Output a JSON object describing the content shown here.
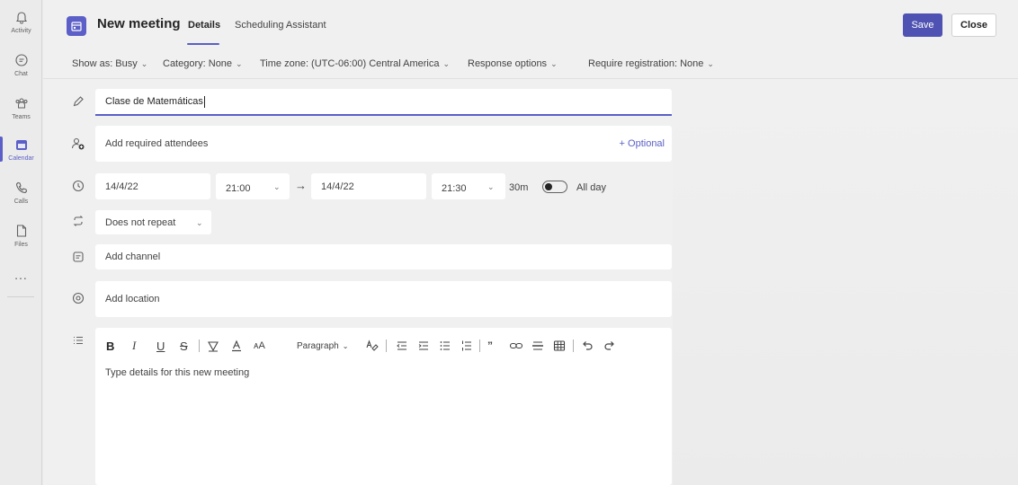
{
  "rail": {
    "items": [
      {
        "label": "Activity",
        "icon": "bell-icon"
      },
      {
        "label": "Chat",
        "icon": "chat-icon"
      },
      {
        "label": "Teams",
        "icon": "teams-icon"
      },
      {
        "label": "Calendar",
        "icon": "calendar-icon",
        "active": true
      },
      {
        "label": "Calls",
        "icon": "phone-icon"
      },
      {
        "label": "Files",
        "icon": "file-icon"
      }
    ],
    "more": "..."
  },
  "header": {
    "title": "New meeting",
    "tabs": [
      {
        "label": "Details",
        "active": true
      },
      {
        "label": "Scheduling Assistant",
        "active": false
      }
    ],
    "save_label": "Save",
    "close_label": "Close"
  },
  "options": {
    "show_as": "Show as: Busy",
    "category": "Category: None",
    "time_zone": "Time zone: (UTC-06:00) Central America",
    "response": "Response options",
    "registration": "Require registration: None"
  },
  "form": {
    "title_value": "Clase de Matemáticas",
    "attendees_placeholder": "Add required attendees",
    "optional_link": "+ Optional",
    "start_date": "14/4/22",
    "start_time": "21:00",
    "end_date": "14/4/22",
    "end_time": "21:30",
    "duration": "30m",
    "all_day_label": "All day",
    "all_day": false,
    "repeat": "Does not repeat",
    "channel_placeholder": "Add channel",
    "location_placeholder": "Add location",
    "details_placeholder": "Type details for this new meeting"
  },
  "editor_toolbar": {
    "bold": "B",
    "italic": "I",
    "underline": "U",
    "strike": "S",
    "paragraph": "Paragraph"
  },
  "colors": {
    "accent": "#5b5fc7",
    "save_button": "#4f52b2"
  }
}
